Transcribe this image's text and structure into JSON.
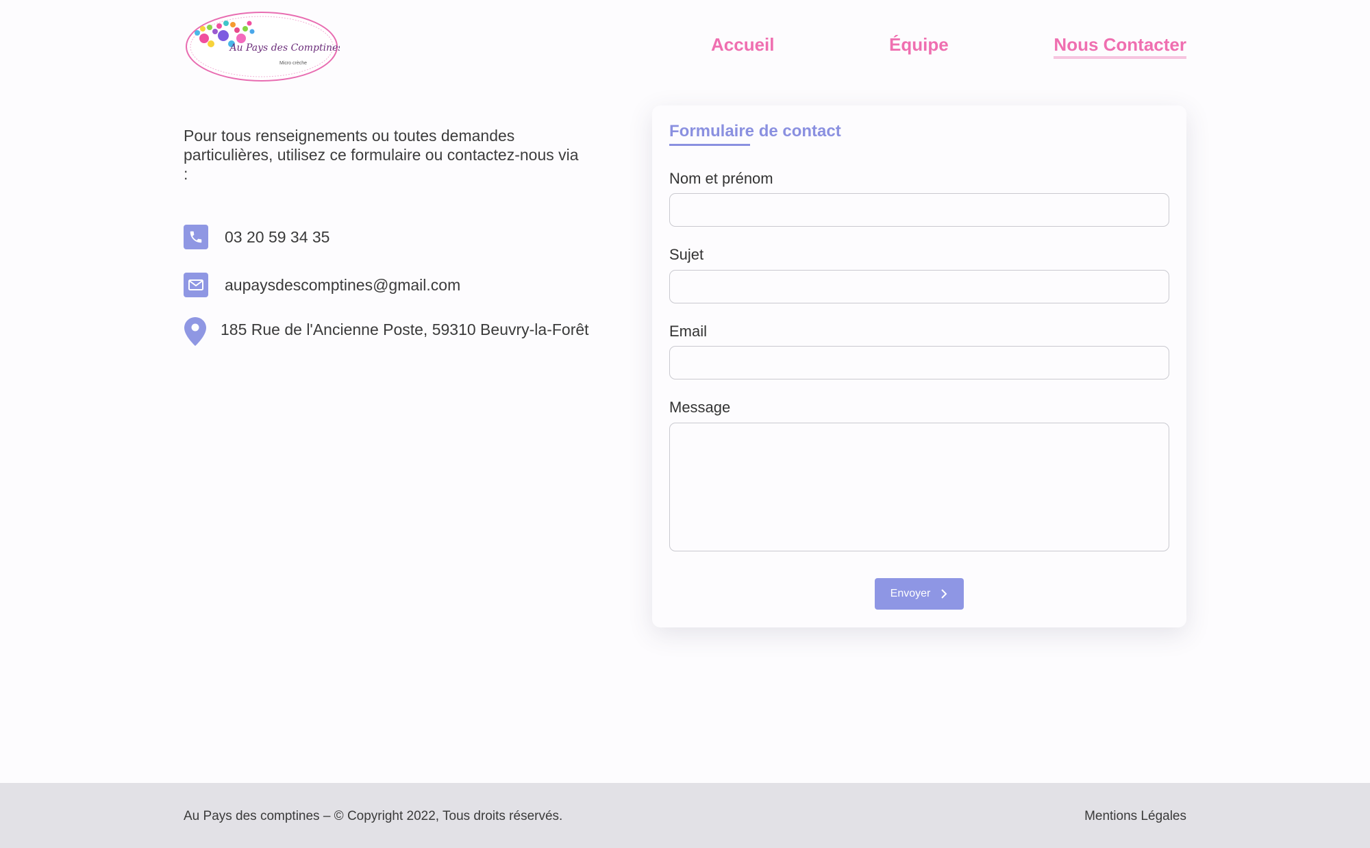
{
  "header": {
    "logo": {
      "text": "Au Pays des Comptines",
      "subtitle": "Micro crèche"
    },
    "nav": [
      {
        "label": "Accueil",
        "active": false
      },
      {
        "label": "Équipe",
        "active": false
      },
      {
        "label": "Nous Contacter",
        "active": true
      }
    ]
  },
  "contact": {
    "intro": "Pour tous renseignements ou toutes demandes particulières, utilisez ce formulaire ou contactez-nous via :",
    "phone": "03 20 59 34 35",
    "email": "aupaysdescomptines@gmail.com",
    "address": "185 Rue de l'Ancienne Poste, 59310 Beuvry-la-Forêt",
    "icons": [
      "phone-icon",
      "mail-icon",
      "map-pin-icon"
    ]
  },
  "form": {
    "title": "Formulaire de contact",
    "fields": {
      "name": {
        "label": "Nom et prénom",
        "value": ""
      },
      "subject": {
        "label": "Sujet",
        "value": ""
      },
      "email": {
        "label": "Email",
        "value": ""
      },
      "message": {
        "label": "Message",
        "value": ""
      }
    },
    "submit_label": "Envoyer"
  },
  "footer": {
    "copyright": "Au Pays des comptines – © Copyright 2022, Tous droits réservés.",
    "legal_link": "Mentions Légales"
  },
  "colors": {
    "accent_pink": "#ef6fb0",
    "accent_lavender": "#8e96e4",
    "footer_bg": "#e2e1e6"
  }
}
